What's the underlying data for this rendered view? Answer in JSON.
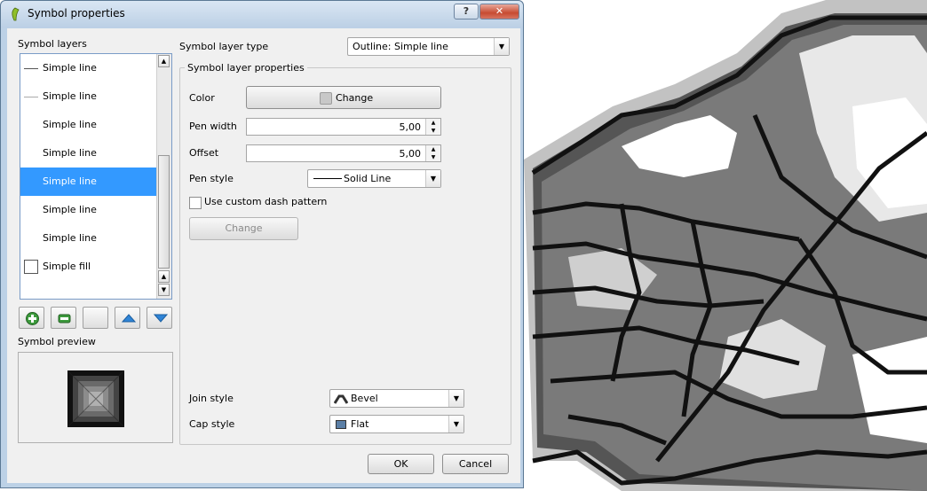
{
  "window": {
    "title": "Symbol properties",
    "help_glyph": "?",
    "close_glyph": "✕"
  },
  "layers": {
    "label": "Symbol layers",
    "items": [
      {
        "label": "Simple line",
        "swatch": "line"
      },
      {
        "label": "Simple line",
        "swatch": "faint-line"
      },
      {
        "label": "Simple line",
        "swatch": "none"
      },
      {
        "label": "Simple line",
        "swatch": "none"
      },
      {
        "label": "Simple line",
        "swatch": "none",
        "selected": true
      },
      {
        "label": "Simple line",
        "swatch": "none"
      },
      {
        "label": "Simple line",
        "swatch": "none"
      },
      {
        "label": "Simple fill",
        "swatch": "fill"
      }
    ],
    "selected_index": 4
  },
  "tools": {
    "add": "plus-icon",
    "remove": "minus-icon",
    "lock": "blank",
    "up": "arrow-up-icon",
    "down": "arrow-down-icon"
  },
  "preview": {
    "label": "Symbol preview"
  },
  "layer_type": {
    "label": "Symbol layer type",
    "value": "Outline: Simple line"
  },
  "props": {
    "title": "Symbol layer properties",
    "color": {
      "label": "Color",
      "button": "Change"
    },
    "pen_width": {
      "label": "Pen width",
      "value": "5,00"
    },
    "offset": {
      "label": "Offset",
      "value": "5,00"
    },
    "pen_style": {
      "label": "Pen style",
      "value": "Solid Line"
    },
    "custom_dash": {
      "label": "Use custom dash pattern",
      "checked": false,
      "button": "Change"
    },
    "join_style": {
      "label": "Join style",
      "value": "Bevel"
    },
    "cap_style": {
      "label": "Cap style",
      "value": "Flat"
    }
  },
  "actions": {
    "ok": "OK",
    "cancel": "Cancel"
  },
  "colors": {
    "selection": "#3399ff",
    "title_bar": "#bcd1e6",
    "close": "#c74b32"
  }
}
